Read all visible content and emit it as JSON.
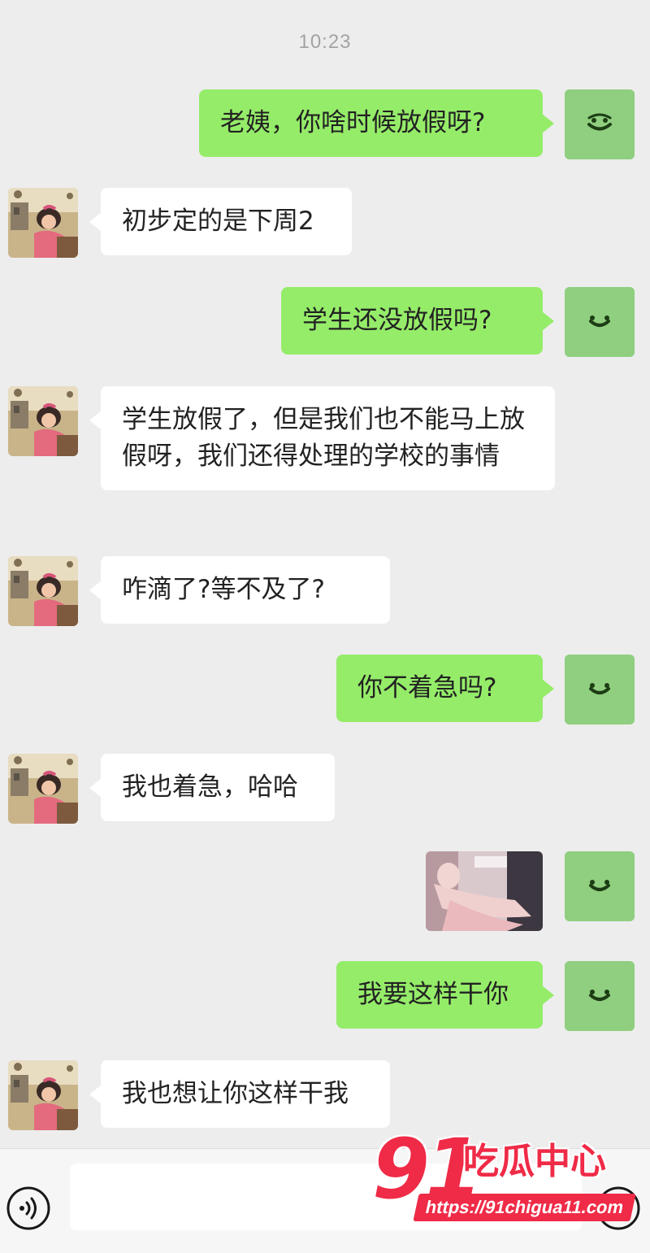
{
  "chat": {
    "timestamp": "10:23",
    "messages": [
      {
        "side": "out",
        "type": "text",
        "text": "老姨，你啥时候放假呀?"
      },
      {
        "side": "in",
        "type": "text",
        "text": "初步定的是下周2"
      },
      {
        "side": "out",
        "type": "text",
        "text": "学生还没放假吗?"
      },
      {
        "side": "in",
        "type": "text",
        "text": "学生放假了，但是我们也不能马上放假呀，我们还得处理的学校的事情"
      },
      {
        "side": "in",
        "type": "text",
        "text": "咋滴了?等不及了?"
      },
      {
        "side": "out",
        "type": "text",
        "text": "你不着急吗?"
      },
      {
        "side": "in",
        "type": "text",
        "text": "我也着急，哈哈"
      },
      {
        "side": "out",
        "type": "image",
        "text": ""
      },
      {
        "side": "out",
        "type": "text",
        "text": "我要这样干你"
      },
      {
        "side": "in",
        "type": "text",
        "text": "我也想让你这样干我"
      }
    ]
  },
  "avatars": {
    "self_icon": "smiley-face-icon",
    "peer_icon": "cartoon-girl-avatar"
  },
  "input_bar": {
    "voice_icon": "voice-icon",
    "input_value": "",
    "plus_icon": "plus-icon"
  },
  "watermark": {
    "number": "91",
    "title": "吃瓜中心",
    "url": "https://91chigua11.com"
  },
  "colors": {
    "background": "#ededed",
    "outgoing_bubble": "#95ec69",
    "incoming_bubble": "#ffffff",
    "self_avatar": "#8fcf7f",
    "watermark": "#ef2b47"
  }
}
